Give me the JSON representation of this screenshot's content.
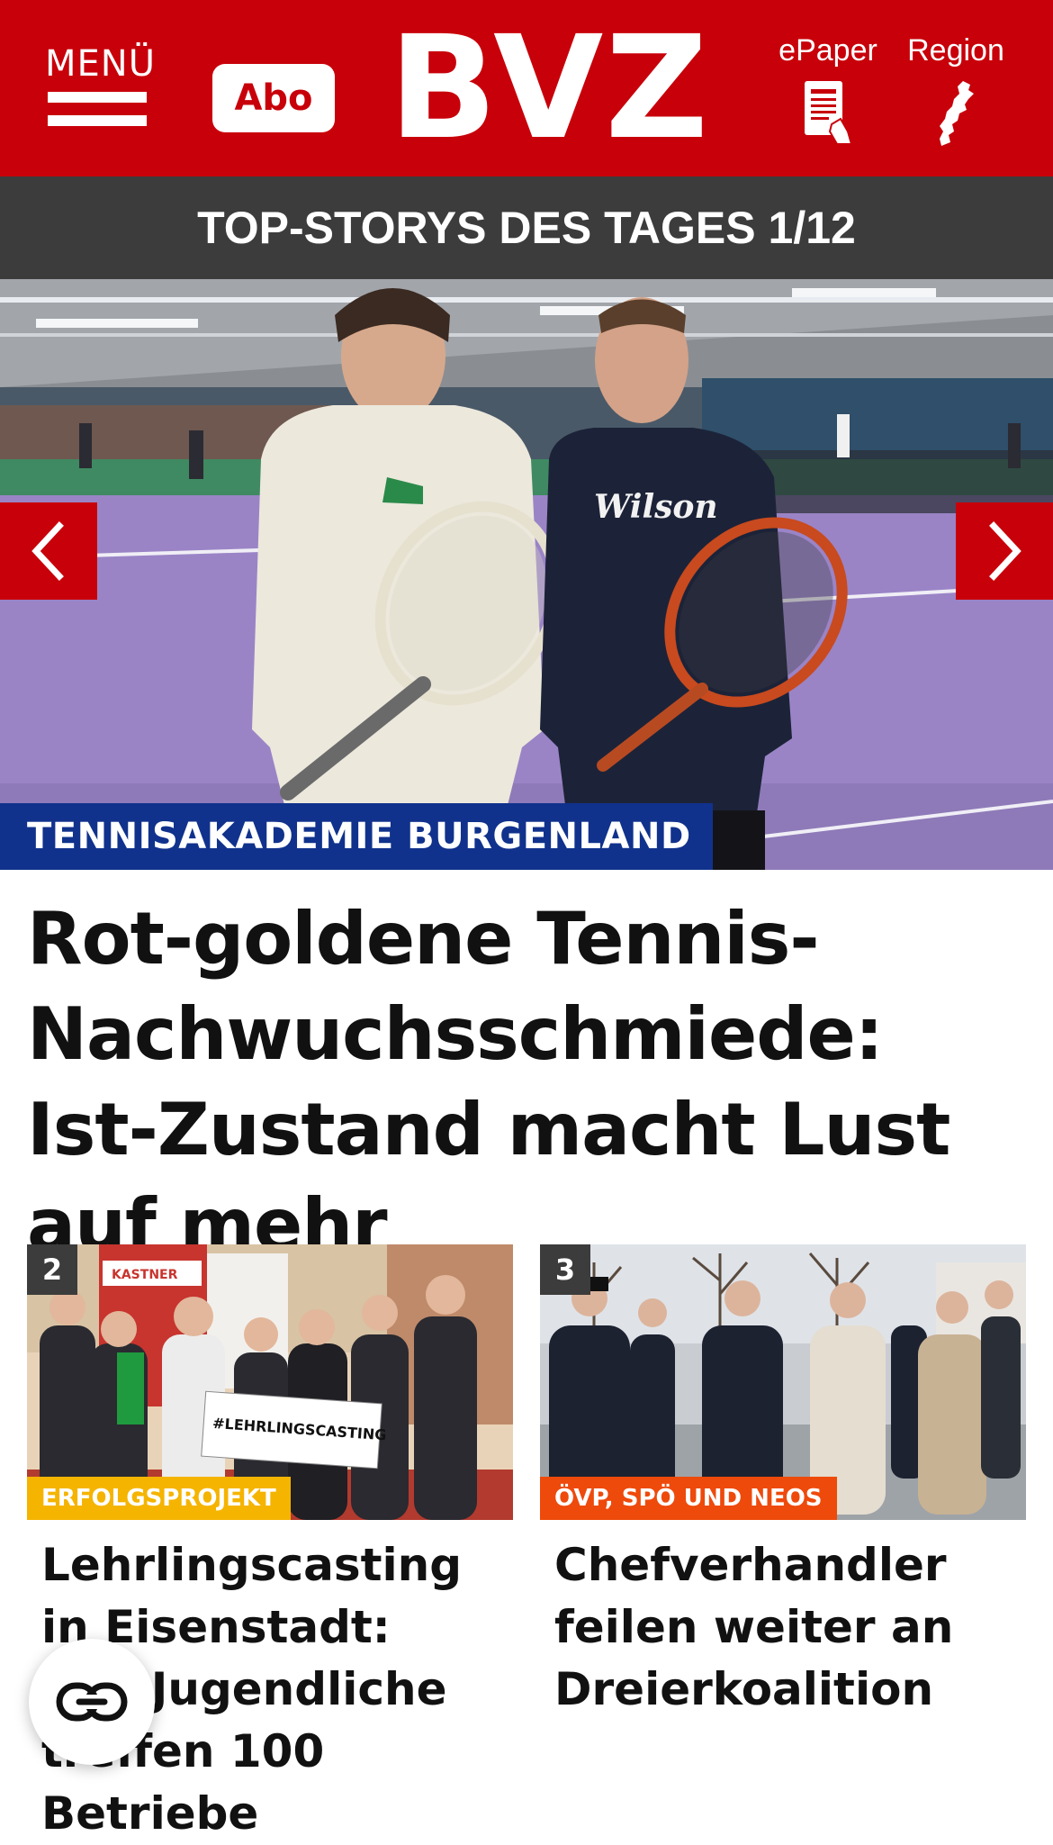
{
  "header": {
    "menu_label": "MENÜ",
    "abo_label": "Abo",
    "logo_text": "BVZ",
    "epaper_label": "ePaper",
    "region_label": "Region"
  },
  "top_stories": {
    "label": "TOP-STORYS DES TAGES 1/12"
  },
  "hero": {
    "tag": "TENNISAKADEMIE BURGENLAND",
    "title": "Rot-goldene Tennis-Nachwuchsschmiede: Ist-Zustand macht Lust auf mehr"
  },
  "cards": [
    {
      "number": "2",
      "tag": "ERFOLGSPROJEKT",
      "title": "Lehrlingscasting in Eisenstadt: 850 Jugendliche treffen 100 Betriebe",
      "sign_text": "#LEHRLINGSCASTING",
      "logo_text": "KASTNER"
    },
    {
      "number": "3",
      "tag": "ÖVP, SPÖ UND NEOS",
      "title": "Chefverhandler feilen weiter an Dreierkoalition"
    }
  ],
  "colors": {
    "brand_red": "#c8000a",
    "dark_bar": "#3c3c3c",
    "hero_tag_blue": "#10328c",
    "tag_yellow": "#f5b400",
    "tag_orange": "#ee4a0c"
  }
}
